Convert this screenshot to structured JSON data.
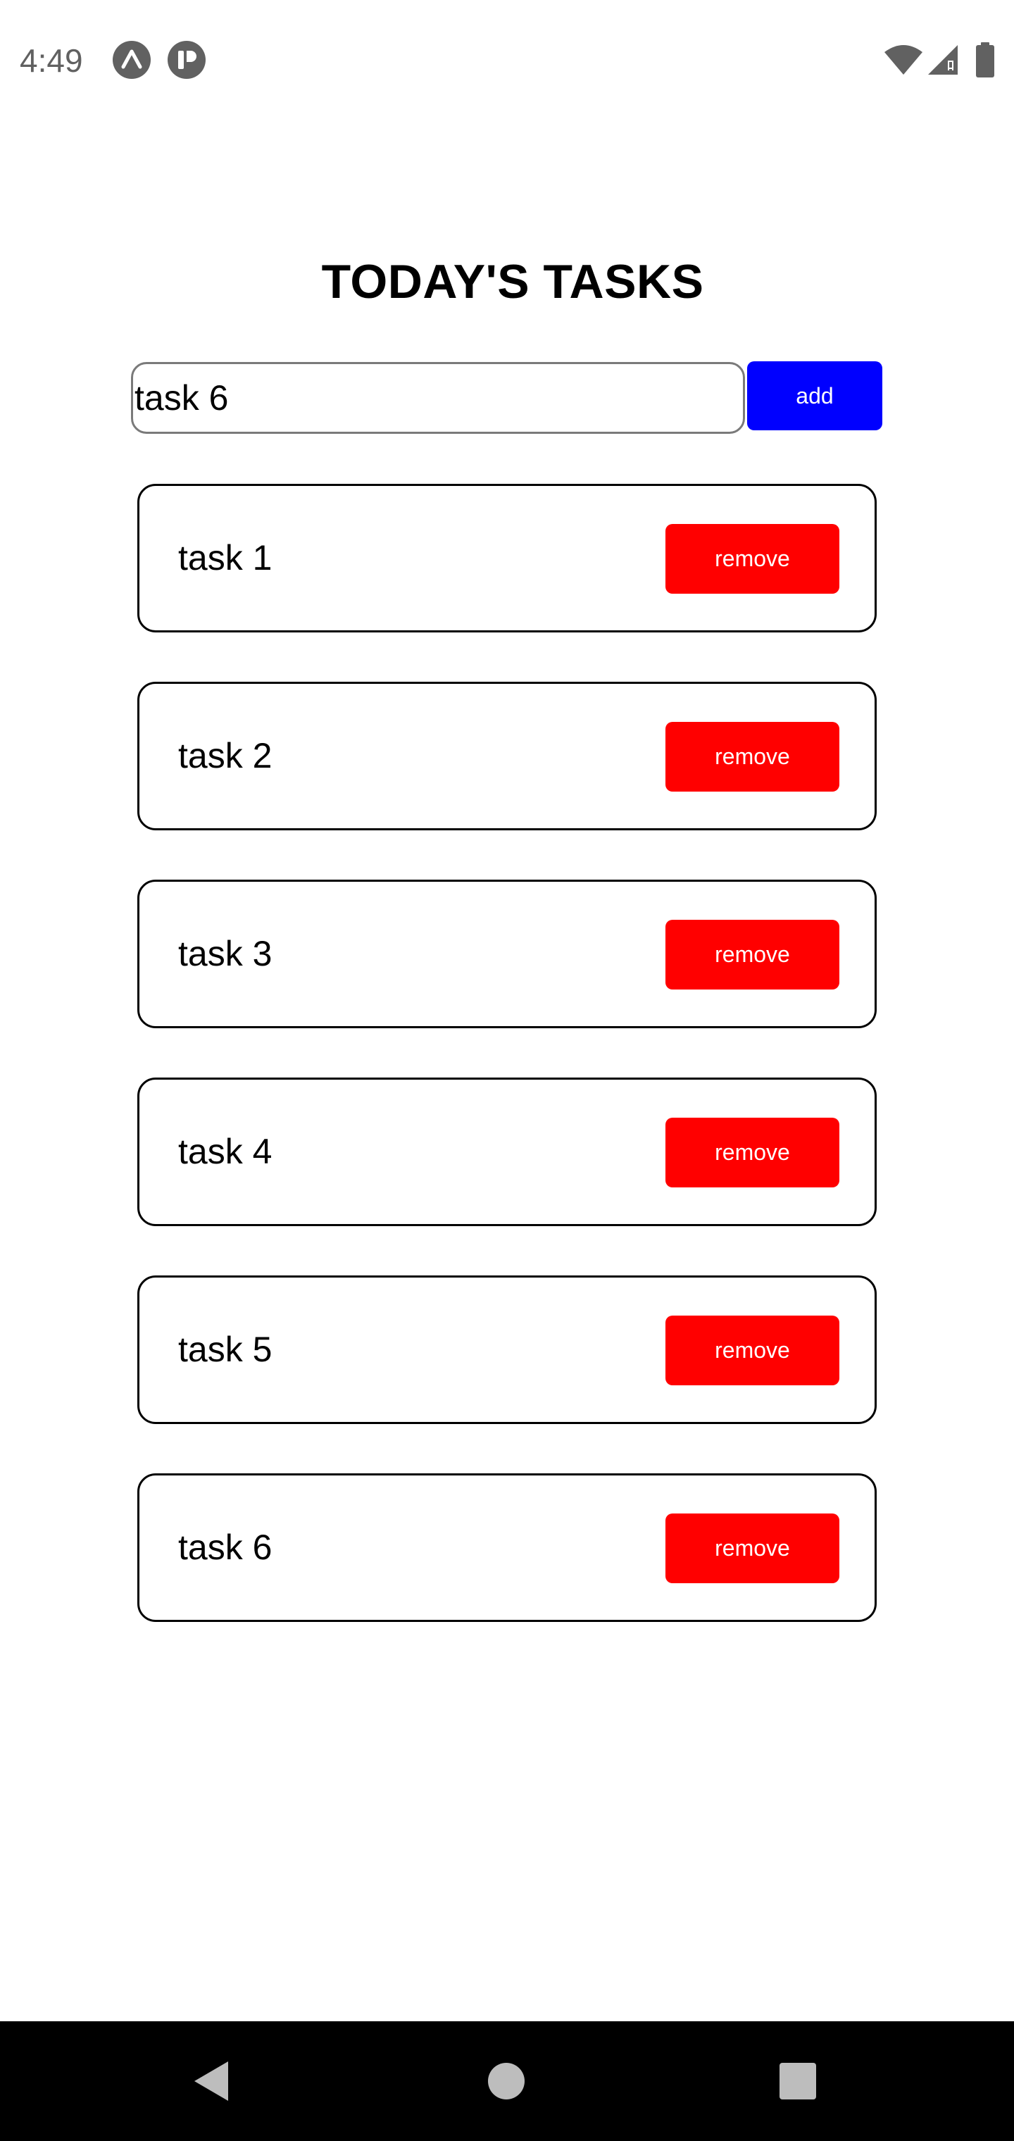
{
  "status_bar": {
    "time": "4:49",
    "left_icons": [
      "expo-icon",
      "app-notification-icon"
    ],
    "right_icons": [
      "wifi-icon",
      "cell-signal-icon",
      "battery-icon"
    ]
  },
  "header": {
    "title": "TODAY'S TASKS"
  },
  "task_input": {
    "value": "task 6",
    "add_label": "add"
  },
  "tasks": [
    {
      "label": "task 1",
      "remove_label": "remove"
    },
    {
      "label": "task 2",
      "remove_label": "remove"
    },
    {
      "label": "task 3",
      "remove_label": "remove"
    },
    {
      "label": "task 4",
      "remove_label": "remove"
    },
    {
      "label": "task 5",
      "remove_label": "remove"
    },
    {
      "label": "task 6",
      "remove_label": "remove"
    }
  ],
  "nav_bar": {
    "icons": [
      "back-icon",
      "home-icon",
      "recents-icon"
    ]
  },
  "colors": {
    "add_button": "#0000ff",
    "remove_button": "#ff0000",
    "nav_bar": "#000000",
    "status_text": "#616161"
  }
}
